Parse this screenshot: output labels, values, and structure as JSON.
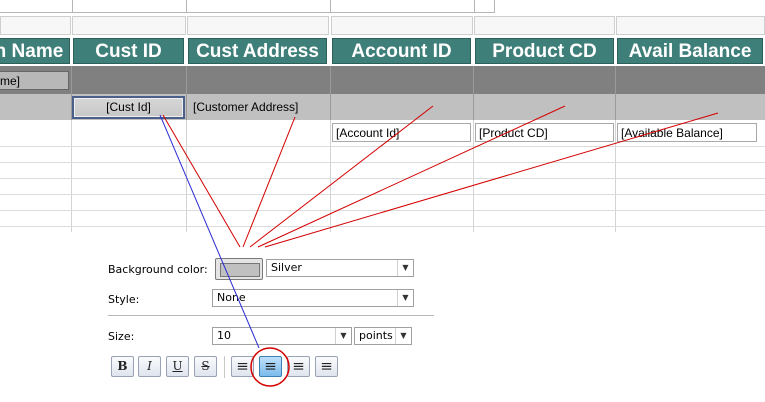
{
  "report": {
    "columns": [
      {
        "header": "n Name"
      },
      {
        "header": "Cust ID"
      },
      {
        "header": "Cust Address"
      },
      {
        "header": "Account ID"
      },
      {
        "header": "Product CD"
      },
      {
        "header": "Avail Balance"
      }
    ],
    "group_field": "me]",
    "detail_fields": {
      "cust_id": "[Cust Id]",
      "customer_address": "[Customer Address]",
      "account_id": "[Account Id]",
      "product_cd": "[Product CD]",
      "available_balance": "[Available Balance]"
    },
    "colors": {
      "header_bg": "#3f7f7a",
      "group_band": "#808080",
      "detail_band": "#c0c0c0"
    }
  },
  "properties": {
    "background_color": {
      "label": "Background color:",
      "value": "Silver",
      "swatch": "#c0c0c0"
    },
    "style": {
      "label": "Style:",
      "value": "None"
    },
    "size": {
      "label": "Size:",
      "value": "10",
      "unit": "points"
    },
    "format_buttons": [
      {
        "name": "bold-icon",
        "glyph": "B"
      },
      {
        "name": "italic-icon",
        "glyph": "I"
      },
      {
        "name": "underline-icon",
        "glyph": "U"
      },
      {
        "name": "strikethrough-icon",
        "glyph": "S"
      }
    ],
    "align_buttons": [
      {
        "name": "align-left-icon",
        "glyph": "≡"
      },
      {
        "name": "align-center-icon",
        "glyph": "≡"
      },
      {
        "name": "align-right-icon",
        "glyph": "≡"
      },
      {
        "name": "align-justify-icon",
        "glyph": "≡"
      }
    ],
    "active_alignment": "align-center-icon"
  }
}
